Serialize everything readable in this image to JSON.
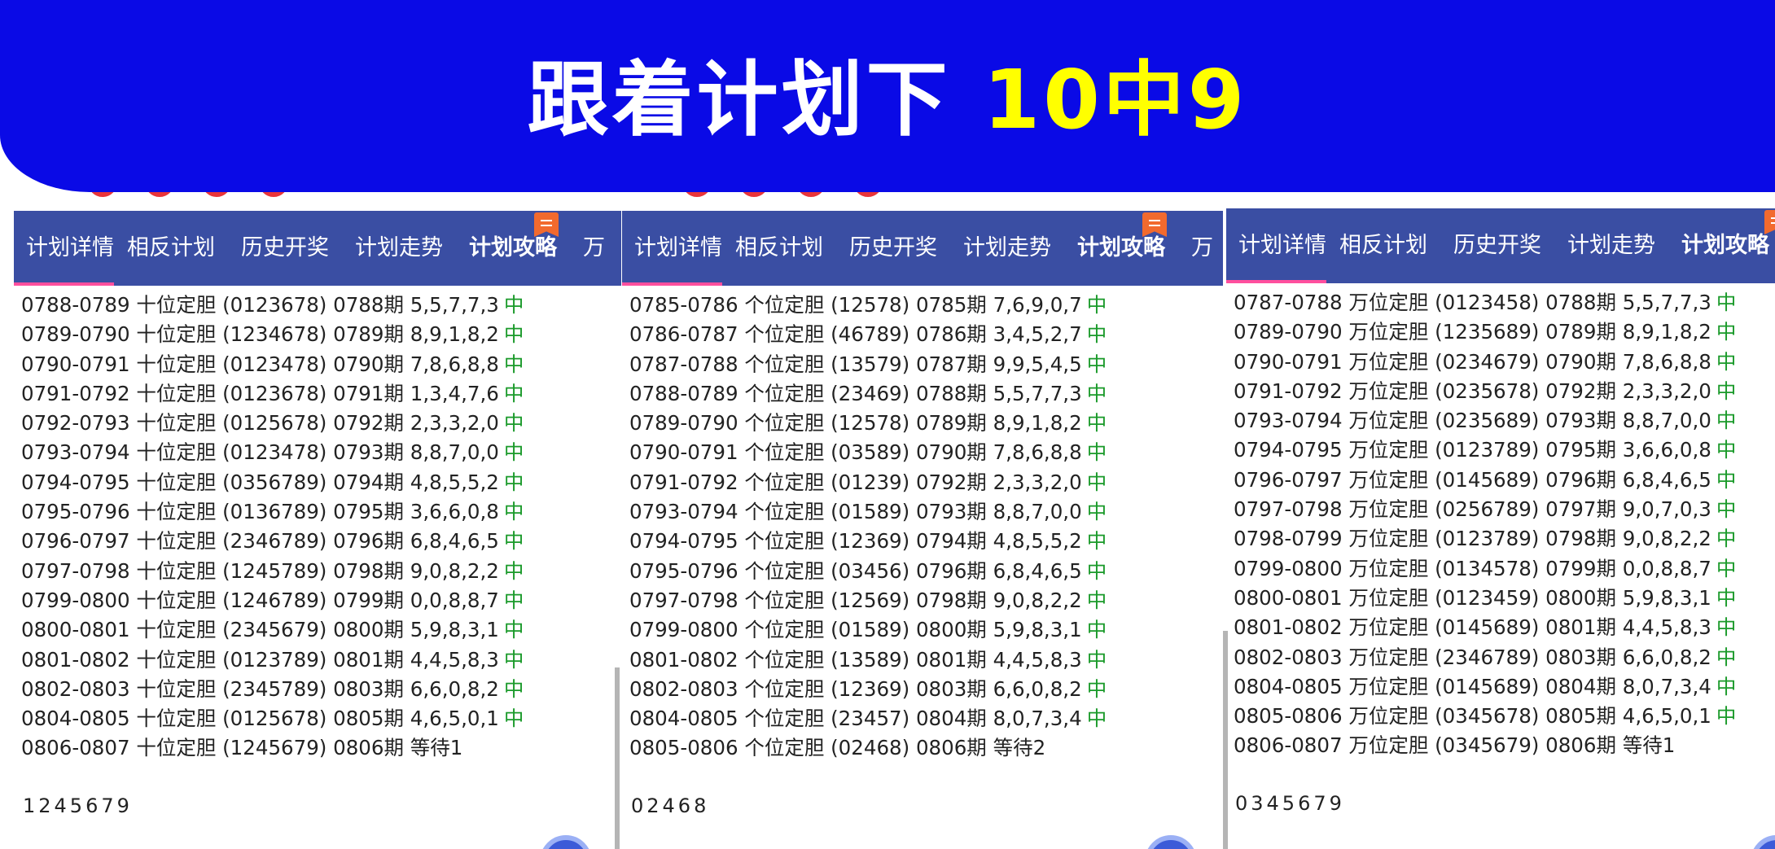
{
  "banner": {
    "title": "跟着计划下",
    "highlight": "10中9",
    "bg_color": "#0a0ae6",
    "highlight_color": "#ffff00"
  },
  "panels": [
    {
      "tabs": [
        "计划详情",
        "相反计划",
        "历史开奖",
        "计划走势",
        "计划攻略",
        "万"
      ],
      "rows": [
        {
          "text": "0788-0789 十位定胆 (0123678) 0788期 5,5,7,7,3",
          "result": "中"
        },
        {
          "text": "0789-0790 十位定胆 (1234678) 0789期 8,9,1,8,2",
          "result": "中"
        },
        {
          "text": "0790-0791 十位定胆 (0123478) 0790期 7,8,6,8,8",
          "result": "中"
        },
        {
          "text": "0791-0792 十位定胆 (0123678) 0791期 1,3,4,7,6",
          "result": "中"
        },
        {
          "text": "0792-0793 十位定胆 (0125678) 0792期 2,3,3,2,0",
          "result": "中"
        },
        {
          "text": "0793-0794 十位定胆 (0123478) 0793期 8,8,7,0,0",
          "result": "中"
        },
        {
          "text": "0794-0795 十位定胆 (0356789) 0794期 4,8,5,5,2",
          "result": "中"
        },
        {
          "text": "0795-0796 十位定胆 (0136789) 0795期 3,6,6,0,8",
          "result": "中"
        },
        {
          "text": "0796-0797 十位定胆 (2346789) 0796期 6,8,4,6,5",
          "result": "中"
        },
        {
          "text": "0797-0798 十位定胆 (1245789) 0798期 9,0,8,2,2",
          "result": "中"
        },
        {
          "text": "0799-0800 十位定胆 (1246789) 0799期 0,0,8,8,7",
          "result": "中"
        },
        {
          "text": "0800-0801 十位定胆 (2345679) 0800期 5,9,8,3,1",
          "result": "中"
        },
        {
          "text": "0801-0802 十位定胆 (0123789) 0801期 4,4,5,8,3",
          "result": "中"
        },
        {
          "text": "0802-0803 十位定胆 (2345789) 0803期 6,6,0,8,2",
          "result": "中"
        },
        {
          "text": "0804-0805 十位定胆 (0125678) 0805期 4,6,5,0,1",
          "result": "中"
        },
        {
          "text": "0806-0807 十位定胆 (1245679) 0806期 等待1",
          "result": ""
        }
      ],
      "digits": "1245679"
    },
    {
      "tabs": [
        "计划详情",
        "相反计划",
        "历史开奖",
        "计划走势",
        "计划攻略",
        "万"
      ],
      "rows": [
        {
          "text": "0785-0786 个位定胆 (12578) 0785期 7,6,9,0,7",
          "result": "中"
        },
        {
          "text": "0786-0787 个位定胆 (46789) 0786期 3,4,5,2,7",
          "result": "中"
        },
        {
          "text": "0787-0788 个位定胆 (13579) 0787期 9,9,5,4,5",
          "result": "中"
        },
        {
          "text": "0788-0789 个位定胆 (23469) 0788期 5,5,7,7,3",
          "result": "中"
        },
        {
          "text": "0789-0790 个位定胆 (12578) 0789期 8,9,1,8,2",
          "result": "中"
        },
        {
          "text": "0790-0791 个位定胆 (03589) 0790期 7,8,6,8,8",
          "result": "中"
        },
        {
          "text": "0791-0792 个位定胆 (01239) 0792期 2,3,3,2,0",
          "result": "中"
        },
        {
          "text": "0793-0794 个位定胆 (01589) 0793期 8,8,7,0,0",
          "result": "中"
        },
        {
          "text": "0794-0795 个位定胆 (12369) 0794期 4,8,5,5,2",
          "result": "中"
        },
        {
          "text": "0795-0796 个位定胆 (03456) 0796期 6,8,4,6,5",
          "result": "中"
        },
        {
          "text": "0797-0798 个位定胆 (12569) 0798期 9,0,8,2,2",
          "result": "中"
        },
        {
          "text": "0799-0800 个位定胆 (01589) 0800期 5,9,8,3,1",
          "result": "中"
        },
        {
          "text": "0801-0802 个位定胆 (13589) 0801期 4,4,5,8,3",
          "result": "中"
        },
        {
          "text": "0802-0803 个位定胆 (12369) 0803期 6,6,0,8,2",
          "result": "中"
        },
        {
          "text": "0804-0805 个位定胆 (23457) 0804期 8,0,7,3,4",
          "result": "中"
        },
        {
          "text": "0805-0806 个位定胆 (02468) 0806期 等待2",
          "result": ""
        }
      ],
      "digits": "02468"
    },
    {
      "tabs": [
        "计划详情",
        "相反计划",
        "历史开奖",
        "计划走势",
        "计划攻略"
      ],
      "rows": [
        {
          "text": "0787-0788 万位定胆 (0123458) 0788期 5,5,7,7,3",
          "result": "中"
        },
        {
          "text": "0789-0790 万位定胆 (1235689) 0789期 8,9,1,8,2",
          "result": "中"
        },
        {
          "text": "0790-0791 万位定胆 (0234679) 0790期 7,8,6,8,8",
          "result": "中"
        },
        {
          "text": "0791-0792 万位定胆 (0235678) 0792期 2,3,3,2,0",
          "result": "中"
        },
        {
          "text": "0793-0794 万位定胆 (0235689) 0793期 8,8,7,0,0",
          "result": "中"
        },
        {
          "text": "0794-0795 万位定胆 (0123789) 0795期 3,6,6,0,8",
          "result": "中"
        },
        {
          "text": "0796-0797 万位定胆 (0145689) 0796期 6,8,4,6,5",
          "result": "中"
        },
        {
          "text": "0797-0798 万位定胆 (0256789) 0797期 9,0,7,0,3",
          "result": "中"
        },
        {
          "text": "0798-0799 万位定胆 (0123789) 0798期 9,0,8,2,2",
          "result": "中"
        },
        {
          "text": "0799-0800 万位定胆 (0134578) 0799期 0,0,8,8,7",
          "result": "中"
        },
        {
          "text": "0800-0801 万位定胆 (0123459) 0800期 5,9,8,3,1",
          "result": "中"
        },
        {
          "text": "0801-0802 万位定胆 (0145689) 0801期 4,4,5,8,3",
          "result": "中"
        },
        {
          "text": "0802-0803 万位定胆 (2346789) 0803期 6,6,0,8,2",
          "result": "中"
        },
        {
          "text": "0804-0805 万位定胆 (0145689) 0804期 8,0,7,3,4",
          "result": "中"
        },
        {
          "text": "0805-0806 万位定胆 (0345678) 0805期 4,6,5,0,1",
          "result": "中"
        },
        {
          "text": "0806-0807 万位定胆 (0345679) 0806期 等待1",
          "result": ""
        }
      ],
      "digits": "0345679"
    }
  ],
  "colors": {
    "tab_bar": "#3a4ea3",
    "active_underline": "#ff4f9e",
    "hit_text": "#1a9a2a"
  }
}
